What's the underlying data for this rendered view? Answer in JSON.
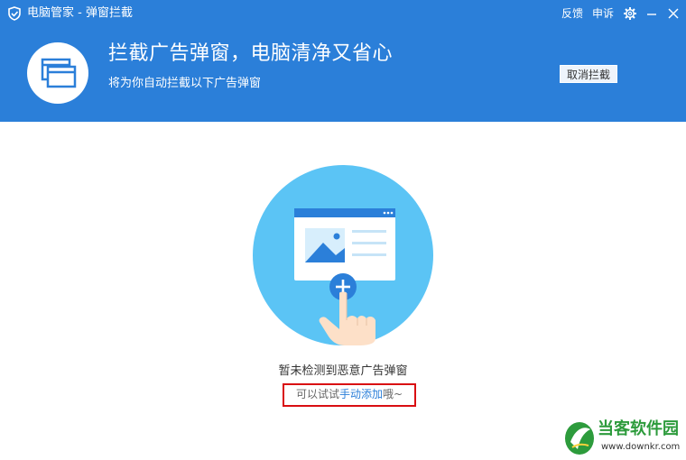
{
  "window": {
    "title": "电脑管家 - 弹窗拦截",
    "feedback_label": "反馈",
    "complain_label": "申诉"
  },
  "banner": {
    "headline": "拦截广告弹窗，电脑清净又省心",
    "subline": "将为你自动拦截以下广告弹窗",
    "cancel_label": "取消拦截"
  },
  "content": {
    "empty_title": "暂未检测到恶意广告弹窗",
    "hint_prefix": "可以试试",
    "hint_link": "手动添加",
    "hint_suffix": "哦~"
  },
  "watermark": {
    "name": "当客软件园",
    "url": "www.downkr.com"
  },
  "colors": {
    "header": "#2b7fd9",
    "illustration_circle": "#5bc4f5",
    "highlight_box": "#d90e12",
    "link": "#2b7fd9"
  }
}
